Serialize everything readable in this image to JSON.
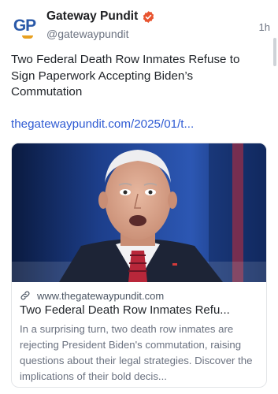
{
  "account": {
    "logo_text": "GP",
    "display_name": "Gateway Pundit",
    "handle": "@gatewaypundit",
    "timestamp": "1h",
    "verified_color": "#e8542f"
  },
  "post": {
    "text": "Two Federal Death Row Inmates Refuse to Sign Paperwork Accepting Biden’s Commutation",
    "link_text": "thegatewaypundit.com/2025/01/t..."
  },
  "card": {
    "image_icon": "news-photo",
    "domain": "www.thegatewaypundit.com",
    "title": "Two Federal Death Row Inmates Refu...",
    "description": "In a surprising turn, two death row inmates are rejecting President Biden's commutation, raising questions about their legal strategies. Discover the implications of their bold decis..."
  },
  "colors": {
    "link": "#2f5bd3",
    "logo_blue": "#2a59a8",
    "logo_orange": "#e8a020"
  }
}
